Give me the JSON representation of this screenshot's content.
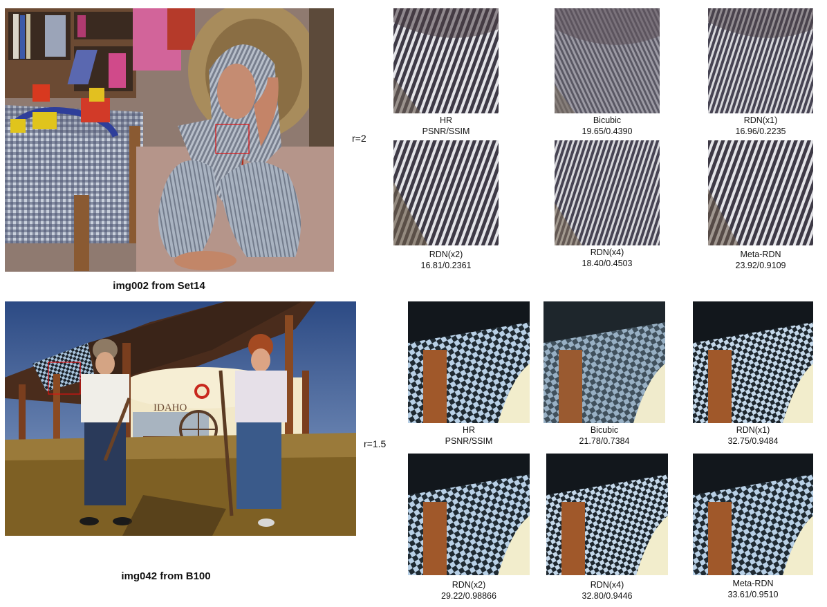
{
  "set1": {
    "caption": "img002 from Set14",
    "ratio": "r=2",
    "patches": [
      {
        "name": "HR",
        "metric": "PSNR/SSIM"
      },
      {
        "name": "Bicubic",
        "metric": "19.65/0.4390"
      },
      {
        "name": "RDN(x1)",
        "metric": "16.96/0.2235"
      },
      {
        "name": "RDN(x2)",
        "metric": "16.81/0.2361"
      },
      {
        "name": "RDN(x4)",
        "metric": "18.40/0.4503"
      },
      {
        "name": "Meta-RDN",
        "metric": "23.92/0.9109"
      }
    ]
  },
  "set2": {
    "caption": "img042 from B100",
    "ratio": "r=1.5",
    "sign_text": "IDAHO",
    "patches": [
      {
        "name": "HR",
        "metric": "PSNR/SSIM"
      },
      {
        "name": "Bicubic",
        "metric": "21.78/0.7384"
      },
      {
        "name": "RDN(x1)",
        "metric": "32.75/0.9484"
      },
      {
        "name": "RDN(x2)",
        "metric": "29.22/0.98866"
      },
      {
        "name": "RDN(x4)",
        "metric": "32.80/0.9446"
      },
      {
        "name": "Meta-RDN",
        "metric": "33.61/0.9510"
      }
    ]
  }
}
